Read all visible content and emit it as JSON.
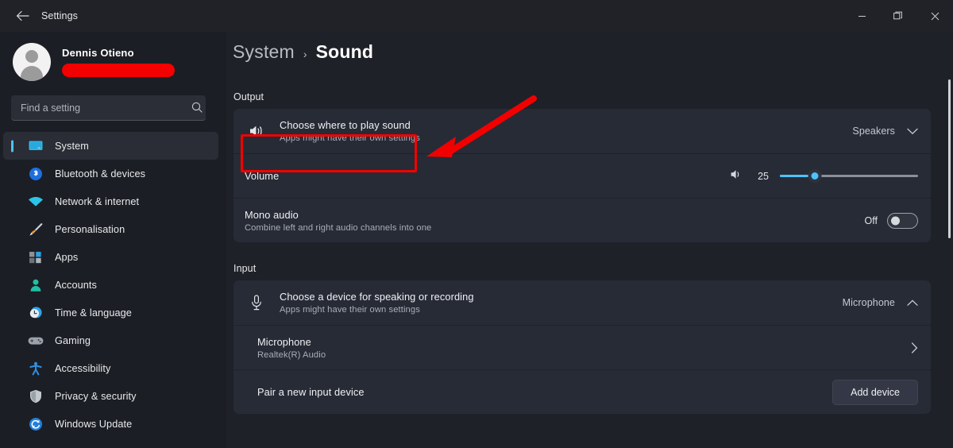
{
  "window": {
    "title": "Settings",
    "back_icon": "back-arrow-icon",
    "minimize_label": "Minimize",
    "maximize_label": "Restore",
    "close_label": "Close"
  },
  "sidebar": {
    "profile": {
      "name": "Dennis Otieno",
      "email_redacted": "",
      "redaction_color": "#f30000"
    },
    "search": {
      "placeholder": "Find a setting",
      "value": "",
      "icon": "search-icon"
    },
    "items": [
      {
        "label": "System",
        "icon": "monitor-icon",
        "active": true
      },
      {
        "label": "Bluetooth & devices",
        "icon": "bluetooth-icon",
        "active": false
      },
      {
        "label": "Network & internet",
        "icon": "wifi-icon",
        "active": false
      },
      {
        "label": "Personalisation",
        "icon": "paintbrush-icon",
        "active": false
      },
      {
        "label": "Apps",
        "icon": "apps-icon",
        "active": false
      },
      {
        "label": "Accounts",
        "icon": "person-icon",
        "active": false
      },
      {
        "label": "Time & language",
        "icon": "clock-icon",
        "active": false
      },
      {
        "label": "Gaming",
        "icon": "gamepad-icon",
        "active": false
      },
      {
        "label": "Accessibility",
        "icon": "accessibility-icon",
        "active": false
      },
      {
        "label": "Privacy & security",
        "icon": "shield-icon",
        "active": false
      },
      {
        "label": "Windows Update",
        "icon": "update-icon",
        "active": false
      }
    ]
  },
  "breadcrumb": {
    "root": "System",
    "separator": "›",
    "current": "Sound"
  },
  "output": {
    "section_label": "Output",
    "choose": {
      "title": "Choose where to play sound",
      "subtitle": "Apps might have their own settings",
      "icon": "speaker-icon",
      "value": "Speakers",
      "chevron": "chevron-down-icon"
    },
    "volume": {
      "title": "Volume",
      "icon": "volume-icon",
      "value": "25",
      "percent": 25
    },
    "mono": {
      "title": "Mono audio",
      "subtitle": "Combine left and right audio channels into one",
      "state_label": "Off",
      "on": false
    }
  },
  "input": {
    "section_label": "Input",
    "choose": {
      "title": "Choose a device for speaking or recording",
      "subtitle": "Apps might have their own settings",
      "icon": "microphone-icon",
      "value": "Microphone",
      "chevron": "chevron-up-icon"
    },
    "device": {
      "title": "Microphone",
      "subtitle": "Realtek(R) Audio",
      "chevron": "chevron-right-icon"
    },
    "pair": {
      "title": "Pair a new input device",
      "button_label": "Add device"
    }
  },
  "annotations": {
    "highlight_color": "#f20000",
    "arrow_color": "#f20000",
    "highlight_target": "choose-where-to-play-sound-row"
  }
}
